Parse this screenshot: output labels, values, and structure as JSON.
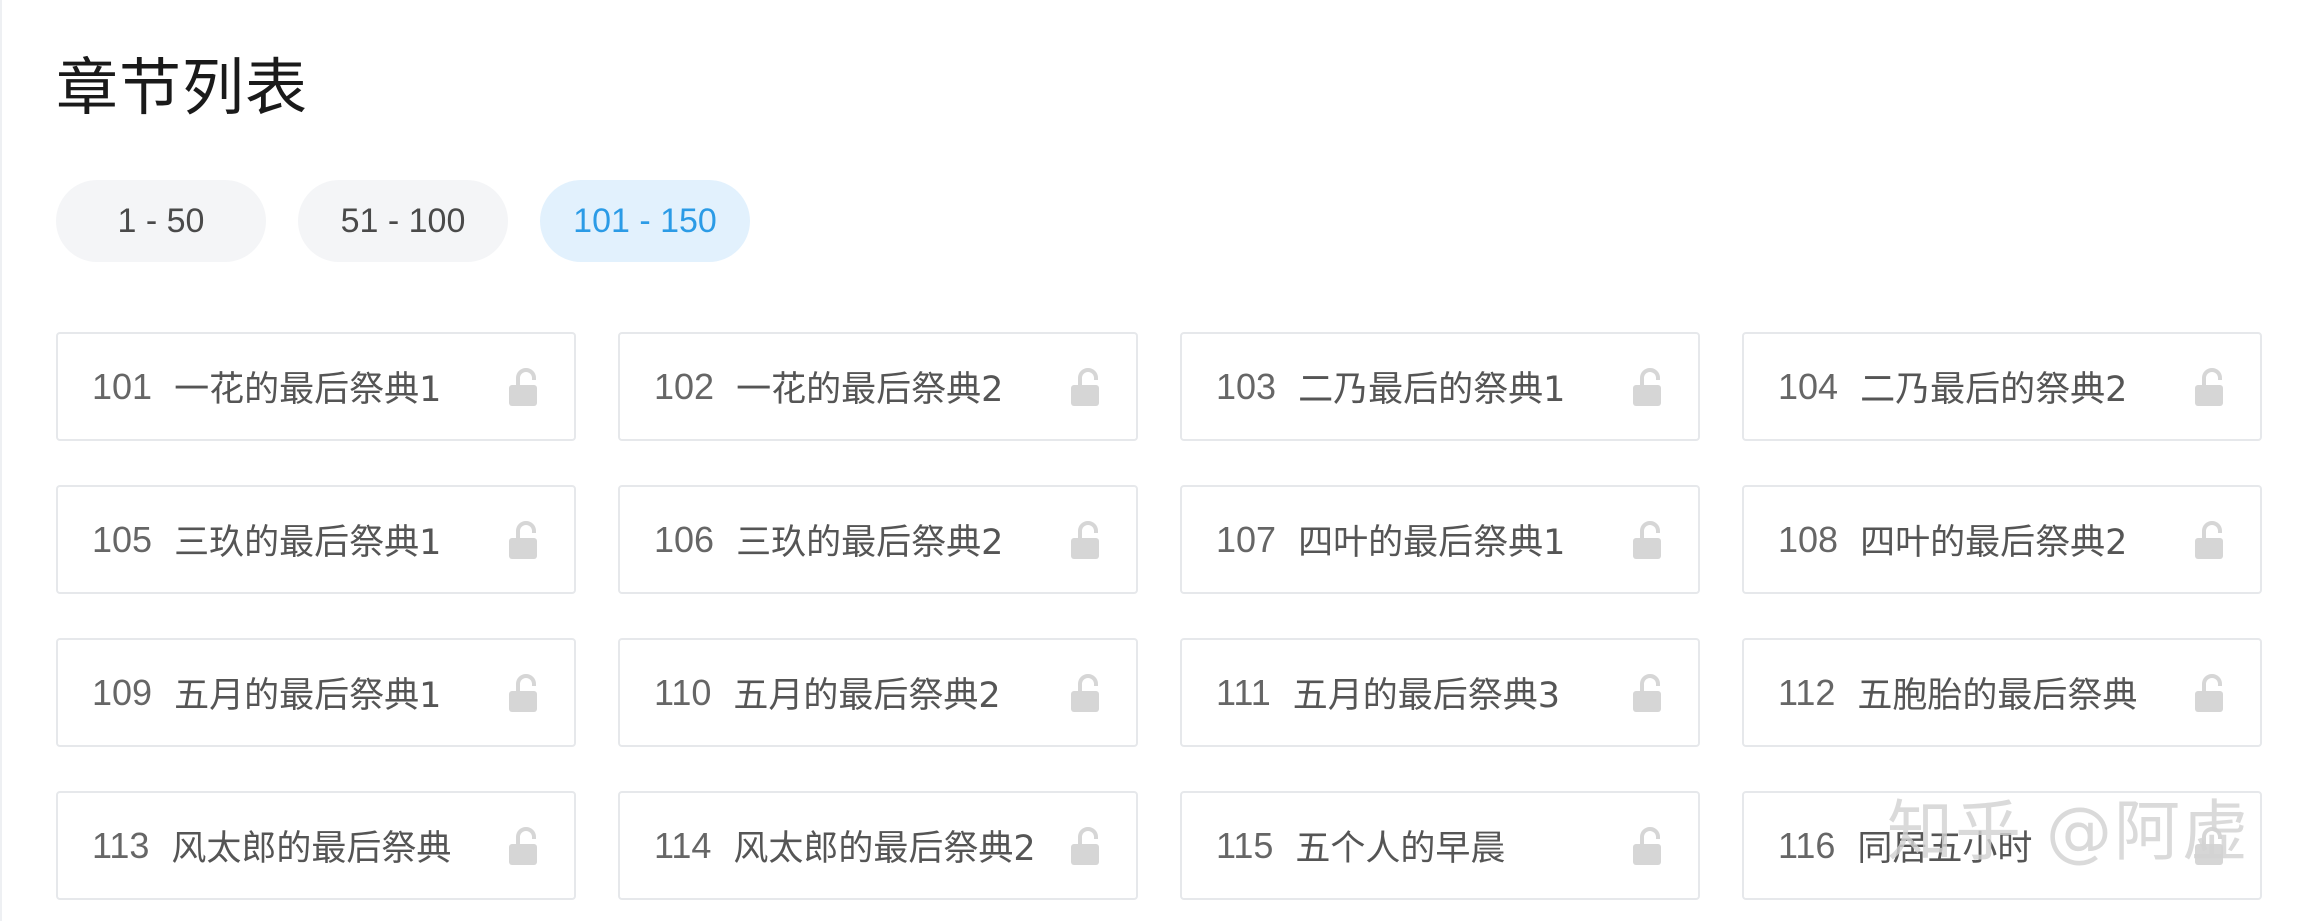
{
  "header": {
    "title": "章节列表"
  },
  "tabs": [
    {
      "label": "1 - 50",
      "active": false
    },
    {
      "label": "51 - 100",
      "active": false
    },
    {
      "label": "101 - 150",
      "active": true
    }
  ],
  "chapters": [
    {
      "num": "101",
      "title": "一花的最后祭典1"
    },
    {
      "num": "102",
      "title": "一花的最后祭典2"
    },
    {
      "num": "103",
      "title": "二乃最后的祭典1"
    },
    {
      "num": "104",
      "title": "二乃最后的祭典2"
    },
    {
      "num": "105",
      "title": "三玖的最后祭典1"
    },
    {
      "num": "106",
      "title": "三玖的最后祭典2"
    },
    {
      "num": "107",
      "title": "四叶的最后祭典1"
    },
    {
      "num": "108",
      "title": "四叶的最后祭典2"
    },
    {
      "num": "109",
      "title": "五月的最后祭典1"
    },
    {
      "num": "110",
      "title": "五月的最后祭典2"
    },
    {
      "num": "111",
      "title": "五月的最后祭典3"
    },
    {
      "num": "112",
      "title": "五胞胎的最后祭典"
    },
    {
      "num": "113",
      "title": "风太郎的最后祭典"
    },
    {
      "num": "114",
      "title": "风太郎的最后祭典2"
    },
    {
      "num": "115",
      "title": "五个人的早晨"
    },
    {
      "num": "116",
      "title": "同居五小时"
    }
  ],
  "icons": {
    "chapter_status": "unlock-icon"
  },
  "colors": {
    "accent": "#2b9be6",
    "active_tab_bg": "#e2f1fd",
    "tab_bg": "#f4f5f7",
    "card_border": "#e6e8eb",
    "lock_icon": "#d6d6d6"
  },
  "watermark": {
    "text": "知乎 @阿虚"
  }
}
